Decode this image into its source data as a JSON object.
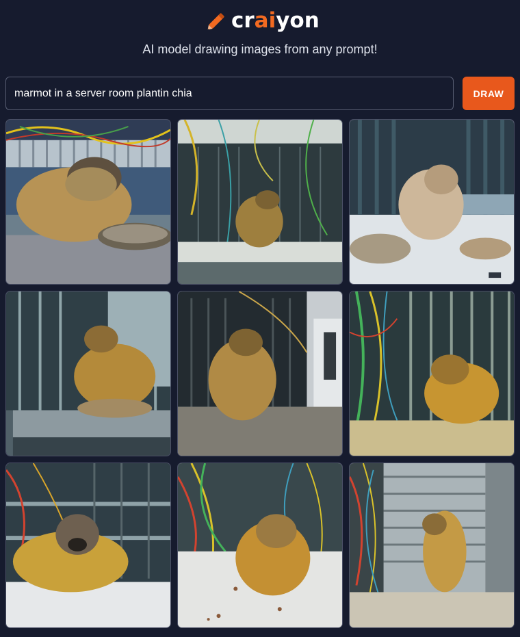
{
  "brand": {
    "name_prefix": "cr",
    "name_accent": "ai",
    "name_suffix": "yon",
    "accent_color": "#f26a21",
    "logo_icon": "pencil-icon"
  },
  "tagline": "AI model drawing images from any prompt!",
  "prompt": {
    "value": "marmot in a server room plantin chia"
  },
  "draw_button": {
    "label": "DRAW",
    "color": "#e8581c"
  },
  "results": [
    {
      "id": "result-image-1",
      "subject": "marmot beside seed pile, cables overhead"
    },
    {
      "id": "result-image-2",
      "subject": "marmot among hanging cables"
    },
    {
      "id": "result-image-3",
      "subject": "marmot with seed trays on white floor"
    },
    {
      "id": "result-image-4",
      "subject": "marmot on table with seeds"
    },
    {
      "id": "result-image-5",
      "subject": "marmot standing by server racks"
    },
    {
      "id": "result-image-6",
      "subject": "marmot in front of green cabled rack"
    },
    {
      "id": "result-image-7",
      "subject": "marmot facing forward on white surface"
    },
    {
      "id": "result-image-8",
      "subject": "marmot sitting among colorful cables"
    },
    {
      "id": "result-image-9",
      "subject": "marmot against rack panel"
    }
  ]
}
